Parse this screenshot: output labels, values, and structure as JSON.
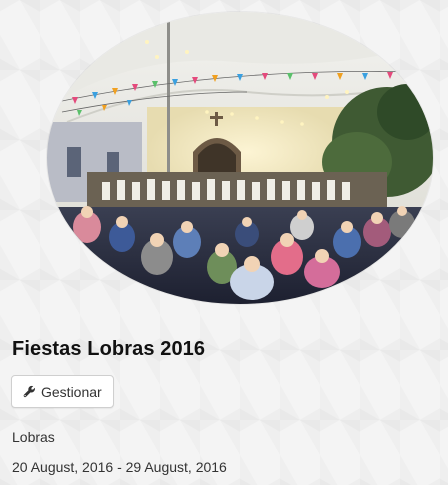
{
  "event": {
    "title": "Fiestas Lobras 2016",
    "manage_label": "Gestionar",
    "location": "Lobras",
    "dates": "20 August, 2016 - 29 August, 2016"
  },
  "icons": {
    "manage": "wrench-icon"
  },
  "colors": {
    "title": "#111111",
    "text": "#333333",
    "button_border": "#cfcfcf",
    "page_background": "#f4f4f4"
  }
}
